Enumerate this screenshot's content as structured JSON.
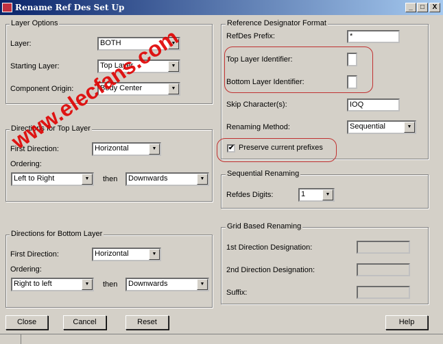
{
  "window": {
    "title": "Rename Ref Des Set Up",
    "minimize": "_",
    "maximize": "□",
    "close": "X"
  },
  "layer_options": {
    "legend": "Layer Options",
    "layer_label": "Layer:",
    "layer_value": "BOTH",
    "starting_label": "Starting Layer:",
    "starting_value": "Top Layer",
    "origin_label": "Component Origin:",
    "origin_value": "Body Center"
  },
  "top_dir": {
    "legend": "Directions for Top Layer",
    "first_label": "First Direction:",
    "first_value": "Horizontal",
    "ordering_label": "Ordering:",
    "order1": "Left to Right",
    "then": "then",
    "order2": "Downwards"
  },
  "bottom_dir": {
    "legend": "Directions for Bottom Layer",
    "first_label": "First Direction:",
    "first_value": "Horizontal",
    "ordering_label": "Ordering:",
    "order1": "Right to left",
    "then": "then",
    "order2": "Downwards"
  },
  "refdes_format": {
    "legend": "Reference Designator Format",
    "prefix_label": "RefDes Prefix:",
    "prefix_value": "*",
    "top_id_label": "Top Layer Identifier:",
    "top_id_value": "",
    "bottom_id_label": "Bottom Layer Identifier:",
    "bottom_id_value": "",
    "skip_label": "Skip Character(s):",
    "skip_value": "IOQ",
    "method_label": "Renaming Method:",
    "method_value": "Sequential",
    "preserve_label": "Preserve current prefixes",
    "preserve_checked": true
  },
  "sequential": {
    "legend": "Sequential Renaming",
    "digits_label": "Refdes Digits:",
    "digits_value": "1"
  },
  "grid": {
    "legend": "Grid Based Renaming",
    "first_label": "1st Direction Designation:",
    "second_label": "2nd Direction Designation:",
    "suffix_label": "Suffix:"
  },
  "buttons": {
    "close": "Close",
    "cancel": "Cancel",
    "reset": "Reset",
    "help": "Help"
  },
  "watermark": "www.elecfans.com",
  "colors": {
    "title_bar": "#0a246a",
    "highlight": "#c03030",
    "watermark": "#e00000"
  }
}
